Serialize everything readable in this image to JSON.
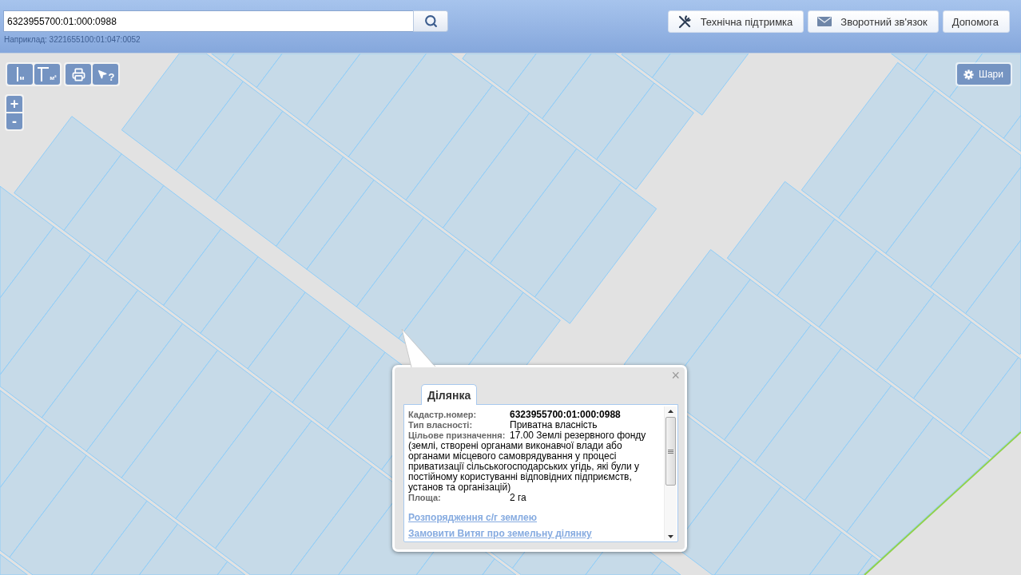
{
  "search": {
    "value": "6323955700:01:000:0988",
    "hint": "Наприклад: 3221655100:01:047:0052"
  },
  "header_buttons": [
    {
      "kind": "support",
      "label": "Технічна підтримка"
    },
    {
      "kind": "feedback",
      "label": "Зворотний зв'язок"
    },
    {
      "kind": "help",
      "label": "Допомога"
    }
  ],
  "map_tools": [
    {
      "items": [
        {
          "kind": "distance",
          "caption": "м"
        },
        {
          "kind": "area",
          "caption": "м²"
        }
      ]
    },
    {
      "items": [
        {
          "kind": "print"
        },
        {
          "kind": "identify",
          "caption": "?"
        }
      ]
    }
  ],
  "zoom": [
    {
      "kind": "in",
      "label": "+"
    },
    {
      "kind": "out",
      "label": "-"
    }
  ],
  "layers_button": {
    "label": "Шари"
  },
  "popup": {
    "close": "×",
    "tabs": [
      {
        "label": "Ділянка",
        "selected": true
      }
    ],
    "fields": [
      {
        "label": "Кадастр.номер:",
        "value": "6323955700:01:000:0988",
        "bold": true
      },
      {
        "label": "Тип власності:",
        "value": "Приватна власність",
        "bold": false
      },
      {
        "label": "Цільове призначення:",
        "value": "17.00 Землі резервного фонду",
        "details": "(землі, створені органами виконавчої влади або органами місцевого самоврядування у процесі приватизації сільськогосподарських угідь, які були у постійному користуванні відповідних підприємств, установ та організацій)",
        "bold": false
      },
      {
        "label": "Площа:",
        "value": "2 га",
        "bold": false
      }
    ],
    "links": [
      "Розпорядження с/г землею",
      "Замовити Витяг про земельну ділянку"
    ]
  }
}
